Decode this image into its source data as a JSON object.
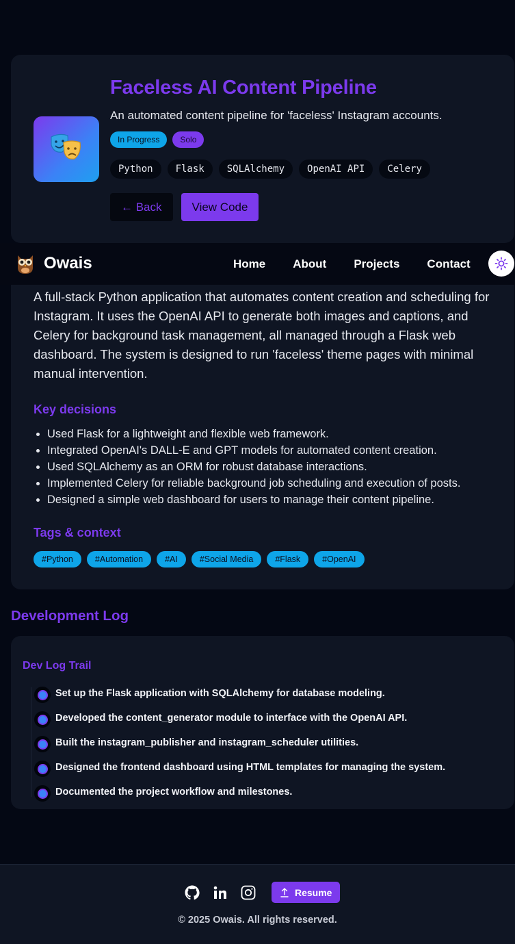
{
  "hero": {
    "title": "Faceless AI Content Pipeline",
    "subtitle": "An automated content pipeline for 'faceless' Instagram accounts.",
    "icon": "theater-masks-icon",
    "badges": [
      "In Progress",
      "Solo"
    ],
    "stack": [
      "Python",
      "Flask",
      "SQLAlchemy",
      "OpenAI API",
      "Celery"
    ],
    "back_label": "← Back",
    "code_label": "View Code"
  },
  "navbar": {
    "brand": "Owais",
    "logo_icon": "owl-icon",
    "links": [
      "Home",
      "About",
      "Projects",
      "Contact"
    ],
    "theme_icon": "sun-icon"
  },
  "details": {
    "description": "A full-stack Python application that automates content creation and scheduling for Instagram. It uses the OpenAI API to generate both images and captions, and Celery for background task management, all managed through a Flask web dashboard. The system is designed to run 'faceless' theme pages with minimal manual intervention.",
    "decisions_heading": "Key decisions",
    "decisions": [
      "Used Flask for a lightweight and flexible web framework.",
      "Integrated OpenAI's DALL-E and GPT models for automated content creation.",
      "Used SQLAlchemy as an ORM for robust database interactions.",
      "Implemented Celery for reliable background job scheduling and execution of posts.",
      "Designed a simple web dashboard for users to manage their content pipeline."
    ],
    "tags_heading": "Tags & context",
    "tags": [
      "#Python",
      "#Automation",
      "#AI",
      "#Social Media",
      "#Flask",
      "#OpenAI"
    ]
  },
  "devlog": {
    "heading": "Development Log",
    "trail_heading": "Dev Log Trail",
    "entries": [
      "Set up the Flask application with SQLAlchemy for database modeling.",
      "Developed the content_generator module to interface with the OpenAI API.",
      "Built the instagram_publisher and instagram_scheduler utilities.",
      "Designed the frontend dashboard using HTML templates for managing the system.",
      "Documented the project workflow and milestones."
    ]
  },
  "footer": {
    "social_icons": [
      "github-icon",
      "linkedin-icon",
      "instagram-icon"
    ],
    "resume_label": "Resume",
    "copyright": "© 2025 Owais. All rights reserved."
  },
  "colors": {
    "accent": "#7c3aed",
    "info": "#0ea5e9",
    "background": "#040814",
    "card": "#0f1523"
  }
}
